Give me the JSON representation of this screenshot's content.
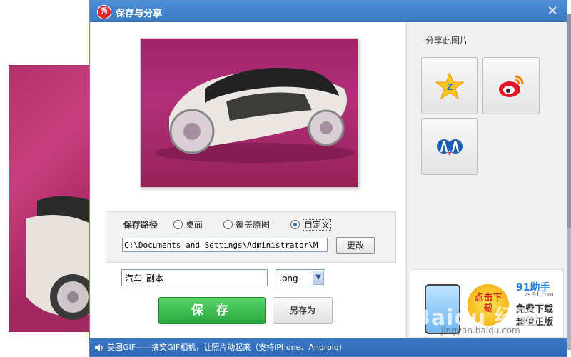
{
  "dialog": {
    "title": "保存与分享",
    "logo_char": "秀",
    "close_glyph": "✕"
  },
  "save_path": {
    "label": "保存路径",
    "options": [
      {
        "label": "桌面",
        "selected": false
      },
      {
        "label": "覆盖原图",
        "selected": false
      },
      {
        "label": "自定义",
        "selected": true
      }
    ],
    "path_value": "C:\\Documents and Settings\\Administrator\\M",
    "change_label": "更改"
  },
  "file": {
    "name_value": "汽车_副本",
    "extension": ".png"
  },
  "buttons": {
    "save_label": "保 存",
    "save_as_label": "另存为"
  },
  "share": {
    "title": "分享此图片",
    "targets": [
      {
        "name": "qzone",
        "icon": "qzone-star-icon"
      },
      {
        "name": "weibo",
        "icon": "weibo-icon"
      },
      {
        "name": "renren",
        "icon": "renren-icon"
      }
    ]
  },
  "ad": {
    "badge": "点击下载",
    "brand": "91助手",
    "domain": "zs.91.com",
    "line1": "免费下载",
    "line2": "超值正版"
  },
  "footer": {
    "text": "美图GIF——搞笑GIF相机，让照片动起来（支持iPhone、Android）"
  },
  "watermark": {
    "text": "Baidu 经验",
    "sub": "jingyan.baidu.com"
  },
  "colors": {
    "titlebar": "#3a77c4",
    "save_green": "#29a840",
    "photo_magenta": "#b3307a"
  }
}
